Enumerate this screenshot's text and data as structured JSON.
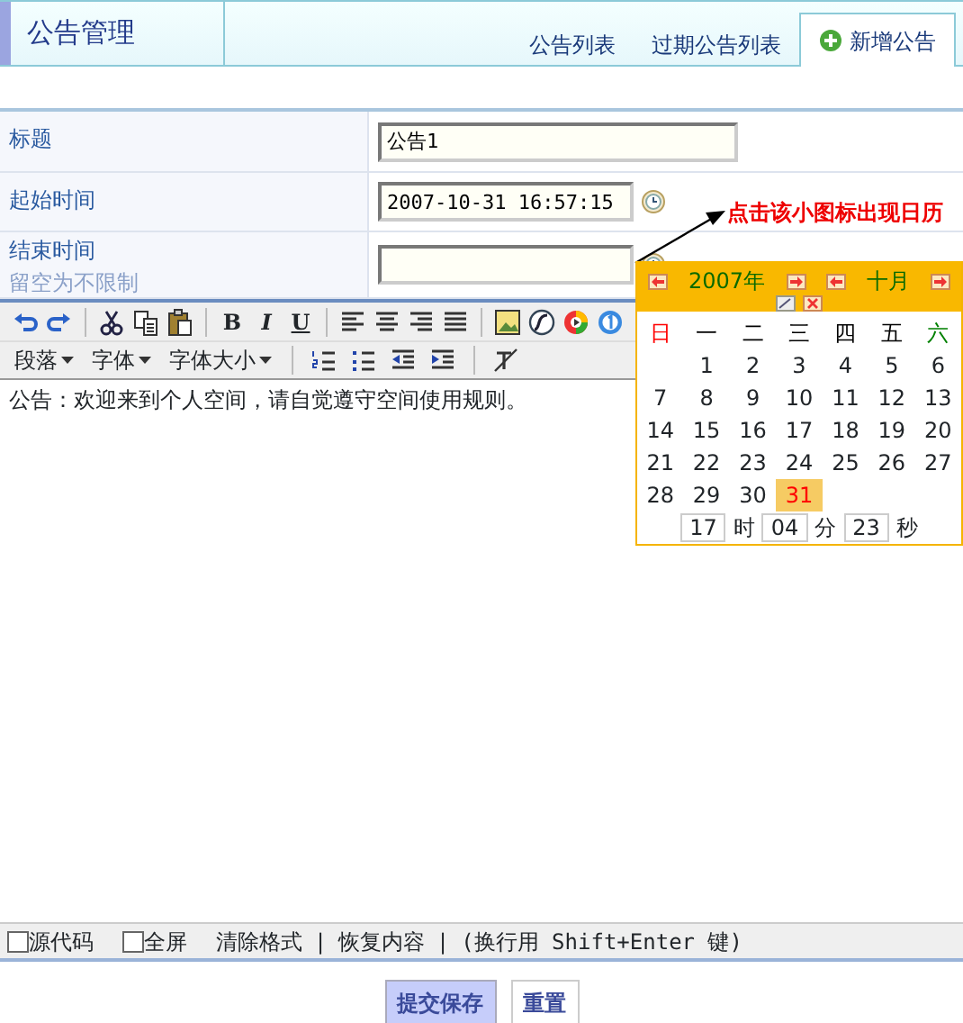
{
  "header": {
    "title": "公告管理",
    "tabs": [
      {
        "label": "公告列表",
        "selected": false
      },
      {
        "label": "过期公告列表",
        "selected": false
      },
      {
        "label": "新增公告",
        "selected": true
      }
    ]
  },
  "form": {
    "fields": [
      {
        "label": "标题",
        "value": "公告1",
        "kind": "text"
      },
      {
        "label": "起始时间",
        "value": "2007-10-31 16:57:15",
        "kind": "date"
      },
      {
        "label": "结束时间",
        "hint": "留空为不限制",
        "kind": "date"
      }
    ]
  },
  "annotation": {
    "text": "点击该小图标出现日历"
  },
  "editor": {
    "formats": [
      "B",
      "I",
      "U"
    ],
    "dropdowns": [
      "段落",
      "字体",
      "字体大小"
    ],
    "content": "公告：欢迎来到个人空间，请自觉遵守空间使用规则。",
    "options": [
      {
        "label": "源代码",
        "checked": false
      },
      {
        "label": "全屏",
        "checked": false
      }
    ],
    "footer_items": [
      {
        "kind": "link",
        "text": "清除格式"
      },
      {
        "kind": "sep",
        "text": "|"
      },
      {
        "kind": "link",
        "text": "恢复内容"
      },
      {
        "kind": "sep",
        "text": "|"
      },
      {
        "kind": "note",
        "text": "(换行用 Shift+Enter 键)"
      }
    ]
  },
  "calendar": {
    "year": "2007年",
    "month": "十月",
    "weekdays": [
      {
        "label": "日",
        "color": "#ff0000"
      },
      {
        "label": "一",
        "color": "#000000"
      },
      {
        "label": "二",
        "color": "#000000"
      },
      {
        "label": "三",
        "color": "#000000"
      },
      {
        "label": "四",
        "color": "#000000"
      },
      {
        "label": "五",
        "color": "#000000"
      },
      {
        "label": "六",
        "color": "#008000"
      }
    ],
    "weeks": [
      [
        {
          "d": "1",
          "selected": false
        },
        {
          "d": "2",
          "selected": false
        },
        {
          "d": "3",
          "selected": false
        },
        {
          "d": "4",
          "selected": false
        },
        {
          "d": "5",
          "selected": false
        },
        {
          "d": "6",
          "selected": false
        }
      ],
      [
        {
          "d": "7",
          "selected": false
        },
        {
          "d": "8",
          "selected": false
        },
        {
          "d": "9",
          "selected": false
        },
        {
          "d": "10",
          "selected": false
        },
        {
          "d": "11",
          "selected": false
        },
        {
          "d": "12",
          "selected": false
        },
        {
          "d": "13",
          "selected": false
        }
      ],
      [
        {
          "d": "14",
          "selected": false
        },
        {
          "d": "15",
          "selected": false
        },
        {
          "d": "16",
          "selected": false
        },
        {
          "d": "17",
          "selected": false
        },
        {
          "d": "18",
          "selected": false
        },
        {
          "d": "19",
          "selected": false
        },
        {
          "d": "20",
          "selected": false
        }
      ],
      [
        {
          "d": "21",
          "selected": false
        },
        {
          "d": "22",
          "selected": false
        },
        {
          "d": "23",
          "selected": false
        },
        {
          "d": "24",
          "selected": false
        },
        {
          "d": "25",
          "selected": false
        },
        {
          "d": "26",
          "selected": false
        },
        {
          "d": "27",
          "selected": false
        }
      ],
      [
        {
          "d": "28",
          "selected": false
        },
        {
          "d": "29",
          "selected": false
        },
        {
          "d": "30",
          "selected": false
        },
        {
          "d": "31",
          "selected": true
        }
      ]
    ],
    "time": [
      {
        "value": "17",
        "unit": "时"
      },
      {
        "value": "04",
        "unit": "分"
      },
      {
        "value": "23",
        "unit": "秒"
      }
    ]
  },
  "buttons": [
    {
      "label": "提交保存",
      "kind": "primary"
    },
    {
      "label": "重置",
      "kind": "plain"
    }
  ]
}
